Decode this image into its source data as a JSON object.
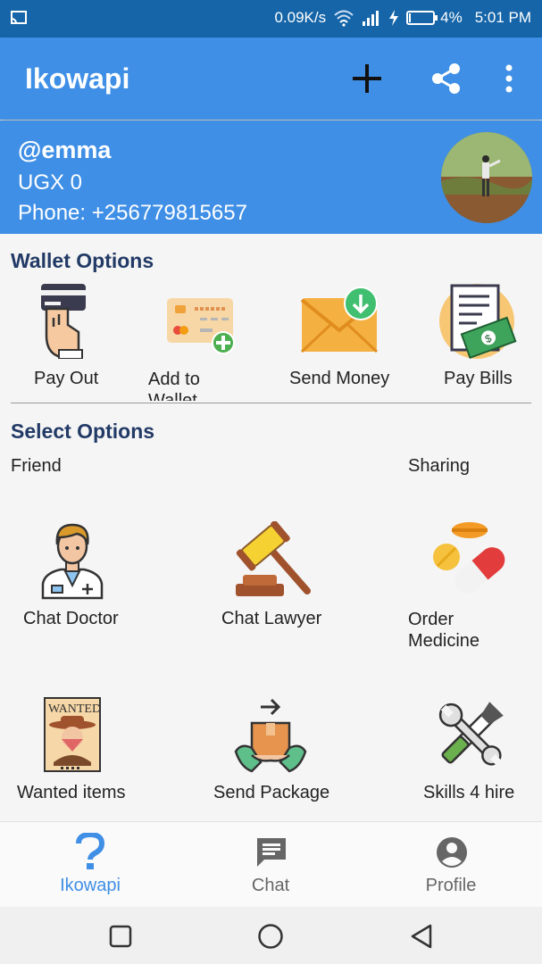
{
  "status_bar": {
    "speed": "0.09K/s",
    "battery": "4%",
    "time": "5:01 PM",
    "icons": [
      "cast-icon",
      "wifi-icon",
      "signal-icon",
      "charging-icon",
      "battery-icon"
    ]
  },
  "app_bar": {
    "title": "Ikowapi",
    "actions": [
      "add-icon",
      "share-icon",
      "more-vert-icon"
    ]
  },
  "profile": {
    "handle": "@emma",
    "balance": "UGX 0",
    "phone": "Phone: +256779815657"
  },
  "wallet": {
    "heading": "Wallet Options",
    "items": [
      {
        "label": "Pay Out",
        "icon": "card-hand-icon"
      },
      {
        "label": "Add to Wallet",
        "icon": "add-card-icon"
      },
      {
        "label": "Send Money",
        "icon": "envelope-download-icon"
      },
      {
        "label": "Pay Bills",
        "icon": "bill-icon"
      }
    ]
  },
  "select": {
    "heading": "Select Options",
    "left_caption": "Friend",
    "right_caption": "Sharing",
    "items": [
      {
        "label": "Chat Doctor",
        "icon": "doctor-icon"
      },
      {
        "label": "Chat Lawyer",
        "icon": "gavel-icon"
      },
      {
        "label": "Order Medicine",
        "icon": "pills-icon"
      },
      {
        "label": "Wanted items",
        "icon": "wanted-poster-icon"
      },
      {
        "label": "Send Package",
        "icon": "package-icon"
      },
      {
        "label": "Skills 4 hire",
        "icon": "tools-icon"
      }
    ]
  },
  "wanted_poster_text": "WANTED",
  "bottom_nav": {
    "items": [
      {
        "label": "Ikowapi",
        "icon": "question-icon",
        "active": true
      },
      {
        "label": "Chat",
        "icon": "chat-icon",
        "active": false
      },
      {
        "label": "Profile",
        "icon": "account-icon",
        "active": false
      }
    ]
  },
  "colors": {
    "status_bar": "#1565a8",
    "app_bar": "#3f8fe6",
    "heading": "#223a66",
    "active_nav": "#3f8fe6",
    "inactive_nav": "#666666"
  }
}
